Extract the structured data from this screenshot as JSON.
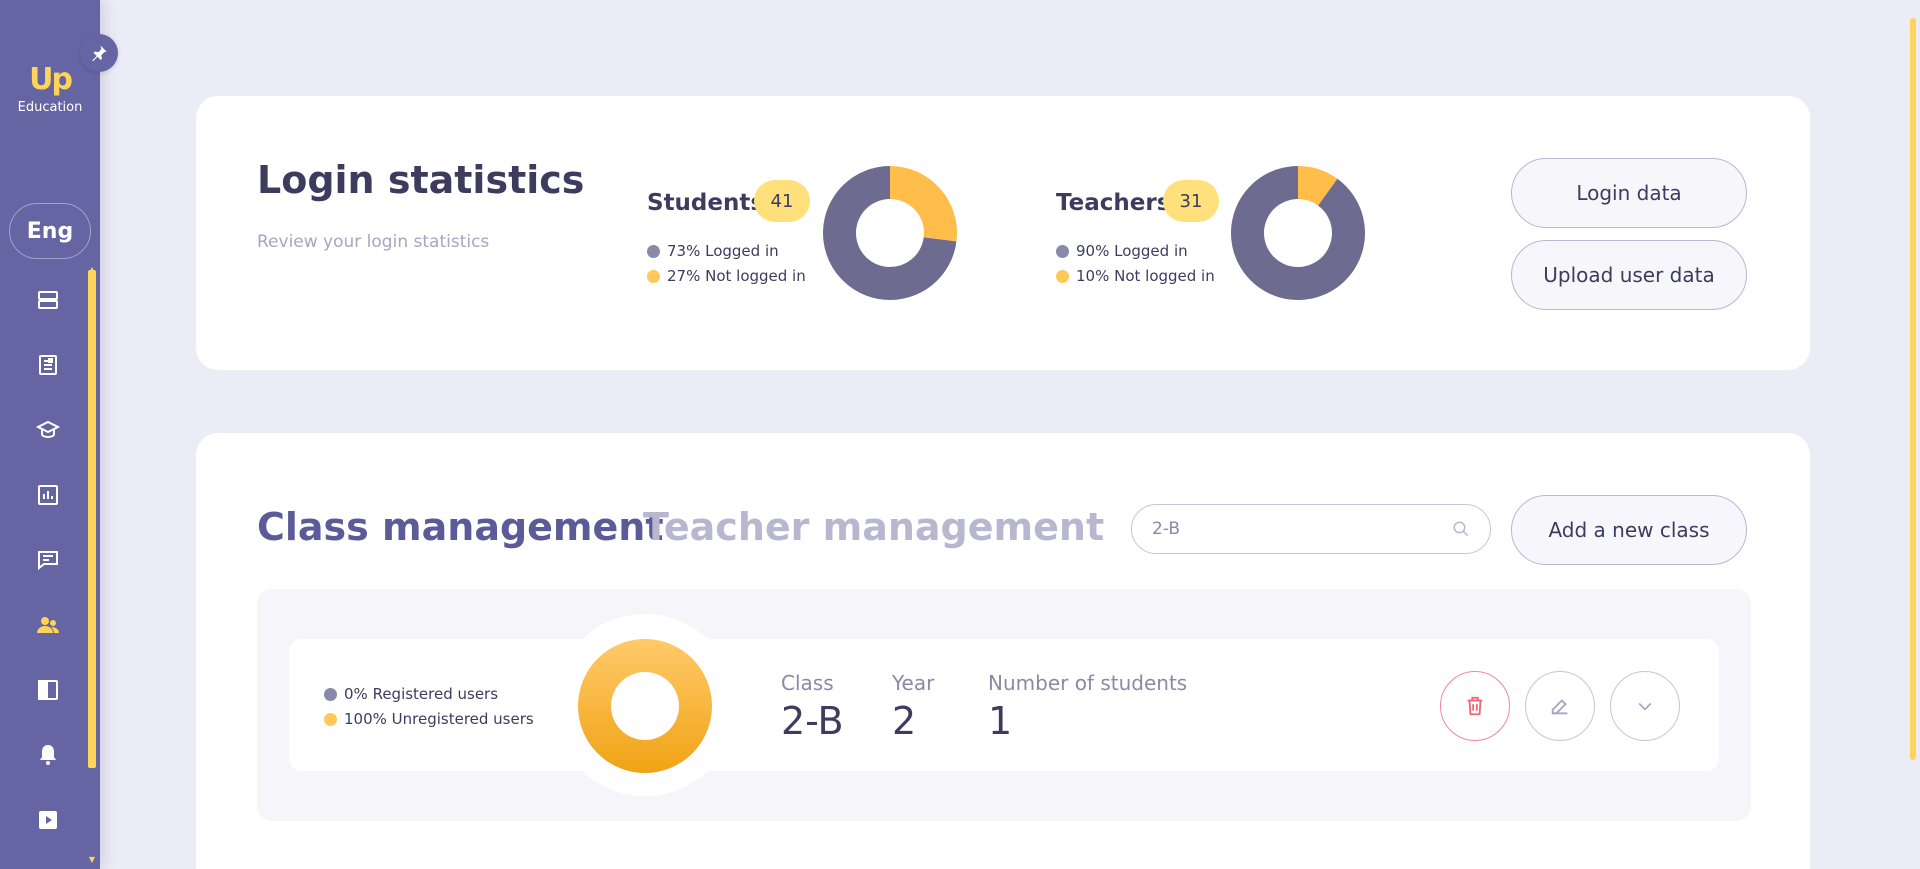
{
  "sidebar": {
    "logo_mark": "Up",
    "logo_text": "Education",
    "language": "Eng",
    "nav_icons": [
      "server-icon",
      "report-icon",
      "graduation-icon",
      "chart-icon",
      "message-icon",
      "users-icon",
      "layout-icon",
      "bell-icon",
      "video-icon"
    ],
    "accent": "#ffd45a",
    "background": "#6665a3"
  },
  "login": {
    "title": "Login statistics",
    "subtitle": "Review your login statistics",
    "students": {
      "heading": "Students",
      "count": "41",
      "logged_in_label": "73% Logged in",
      "not_logged_in_label": "27% Not logged in",
      "logged_in_pct": 73,
      "not_logged_in_pct": 27
    },
    "teachers": {
      "heading": "Teachers",
      "count": "31",
      "logged_in_label": "90% Logged in",
      "not_logged_in_label": "10% Not logged in",
      "logged_in_pct": 90,
      "not_logged_in_pct": 10
    },
    "login_data_button": "Login data",
    "upload_button": "Upload user data"
  },
  "management": {
    "tab_class": "Class management",
    "tab_teacher": "Teacher management",
    "search_value": "2-B",
    "add_button": "Add a new class",
    "class_item": {
      "registered_label": "0% Registered users",
      "unregistered_label": "100% Unregistered users",
      "registered_pct": 0,
      "unregistered_pct": 100,
      "class_label": "Class",
      "class_value": "2-B",
      "year_label": "Year",
      "year_value": "2",
      "students_label": "Number of students",
      "students_value": "1"
    }
  },
  "colors": {
    "grey_segment": "#6d6b8f",
    "yellow_segment": "#ffbd4a",
    "delete": "#f06676"
  }
}
